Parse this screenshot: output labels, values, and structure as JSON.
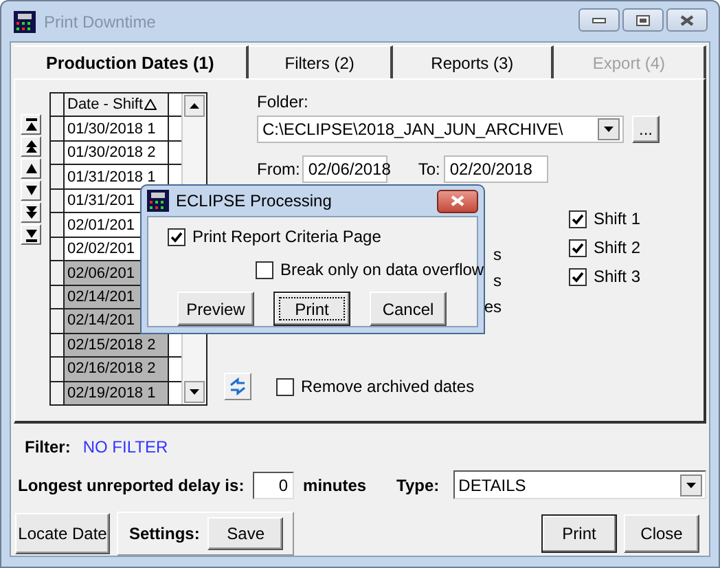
{
  "window": {
    "title": "Print Downtime"
  },
  "tabs": [
    {
      "label": "Production Dates (1)",
      "selected": true,
      "disabled": false
    },
    {
      "label": "Filters (2)",
      "selected": false,
      "disabled": false
    },
    {
      "label": "Reports (3)",
      "selected": false,
      "disabled": false
    },
    {
      "label": "Export  (4)",
      "selected": false,
      "disabled": true
    }
  ],
  "dates_grid": {
    "column": "Date - Shift",
    "rows": [
      {
        "text": "01/30/2018 1",
        "selected": false
      },
      {
        "text": "01/30/2018 2",
        "selected": false
      },
      {
        "text": "01/31/2018 1",
        "selected": false
      },
      {
        "text": "01/31/201",
        "selected": false
      },
      {
        "text": "02/01/201",
        "selected": false
      },
      {
        "text": "02/02/201",
        "selected": false
      },
      {
        "text": "02/06/201",
        "selected": true
      },
      {
        "text": "02/14/201",
        "selected": true
      },
      {
        "text": "02/14/201",
        "selected": true
      },
      {
        "text": "02/15/2018 2",
        "selected": true
      },
      {
        "text": "02/16/2018 2",
        "selected": true
      },
      {
        "text": "02/19/2018 1",
        "selected": true
      }
    ]
  },
  "folder": {
    "label": "Folder:",
    "value": "C:\\ECLIPSE\\2018_JAN_JUN_ARCHIVE\\",
    "browse": "..."
  },
  "from": {
    "label": "From:",
    "value": "02/06/2018"
  },
  "to": {
    "label": "To:",
    "value": "02/20/2018"
  },
  "partly_hidden_texts": [
    "s",
    "s",
    "es"
  ],
  "shifts": [
    {
      "label": "Shift 1",
      "checked": true
    },
    {
      "label": "Shift 2",
      "checked": true
    },
    {
      "label": "Shift 3",
      "checked": true
    }
  ],
  "remove_archived": {
    "label": "Remove archived dates",
    "checked": false
  },
  "filter": {
    "label": "Filter:",
    "value": "NO FILTER"
  },
  "delay": {
    "label": "Longest unreported delay is:",
    "value": "0",
    "unit": "minutes"
  },
  "type": {
    "label": "Type:",
    "value": "DETAILS"
  },
  "buttons": {
    "locate": "Locate Date",
    "settings_label": "Settings:",
    "save": "Save",
    "print": "Print",
    "close": "Close"
  },
  "dialog": {
    "title": "ECLIPSE Processing",
    "options": [
      {
        "label": "Print Report Criteria Page",
        "checked": true
      },
      {
        "label": "Break only on data overflow",
        "checked": false
      }
    ],
    "buttons": [
      {
        "label": "Preview",
        "focused": false
      },
      {
        "label": "Print",
        "focused": true
      },
      {
        "label": "Cancel",
        "focused": false
      }
    ]
  }
}
